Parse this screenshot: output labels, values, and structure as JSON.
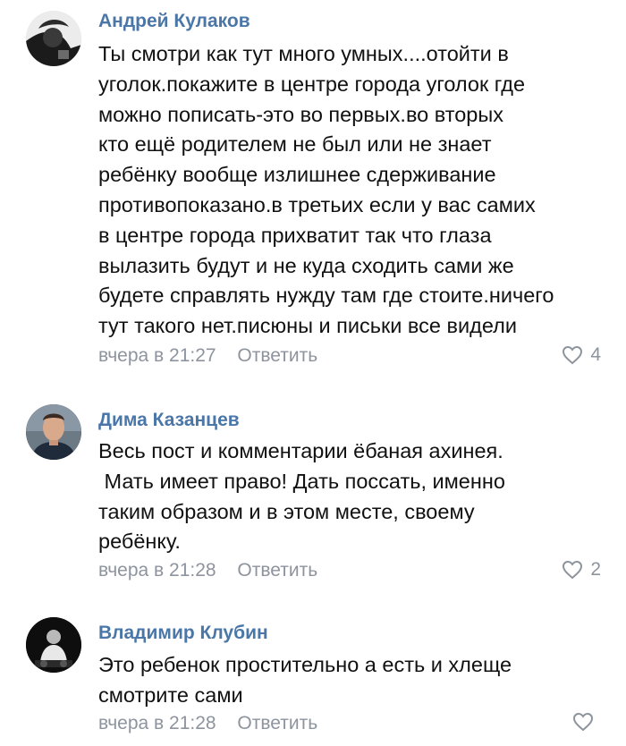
{
  "comments": [
    {
      "author": "Андрей Кулаков",
      "lines": [
        "Ты смотри как тут много умных....отойти в",
        "уголок.покажите в центре города уголок где",
        "можно пописать-это во первых.во вторых",
        "кто ещё родителем не был или не знает",
        "ребёнку вообще излишнее сдерживание",
        "противопоказано.в третьих если у вас самих",
        "в центре города прихватит так что глаза",
        "вылазить будут и не куда сходить сами же",
        "будете справлять нужду там где стоите.ничего",
        "тут такого нет.писюны и письки все видели"
      ],
      "time": "вчера в 21:27",
      "reply": "Ответить",
      "likes": "4"
    },
    {
      "author": "Дима Казанцев",
      "lines": [
        "Весь пост и комментарии ёбаная ахинея.",
        " Мать имеет право! Дать поссать, именно",
        "таким образом и в этом месте, своему",
        "ребёнку."
      ],
      "time": "вчера в 21:28",
      "reply": "Ответить",
      "likes": "2"
    },
    {
      "author": "Владимир Клубин",
      "lines": [
        "Это ребенок простительно а есть и хлеще",
        "смотрите сами"
      ],
      "time": "вчера в 21:28",
      "reply": "Ответить",
      "likes": ""
    }
  ],
  "icons": {
    "like": "heart-outline-icon"
  },
  "colors": {
    "author": "#4a76a8",
    "meta": "#8d949e",
    "text": "#111111"
  }
}
